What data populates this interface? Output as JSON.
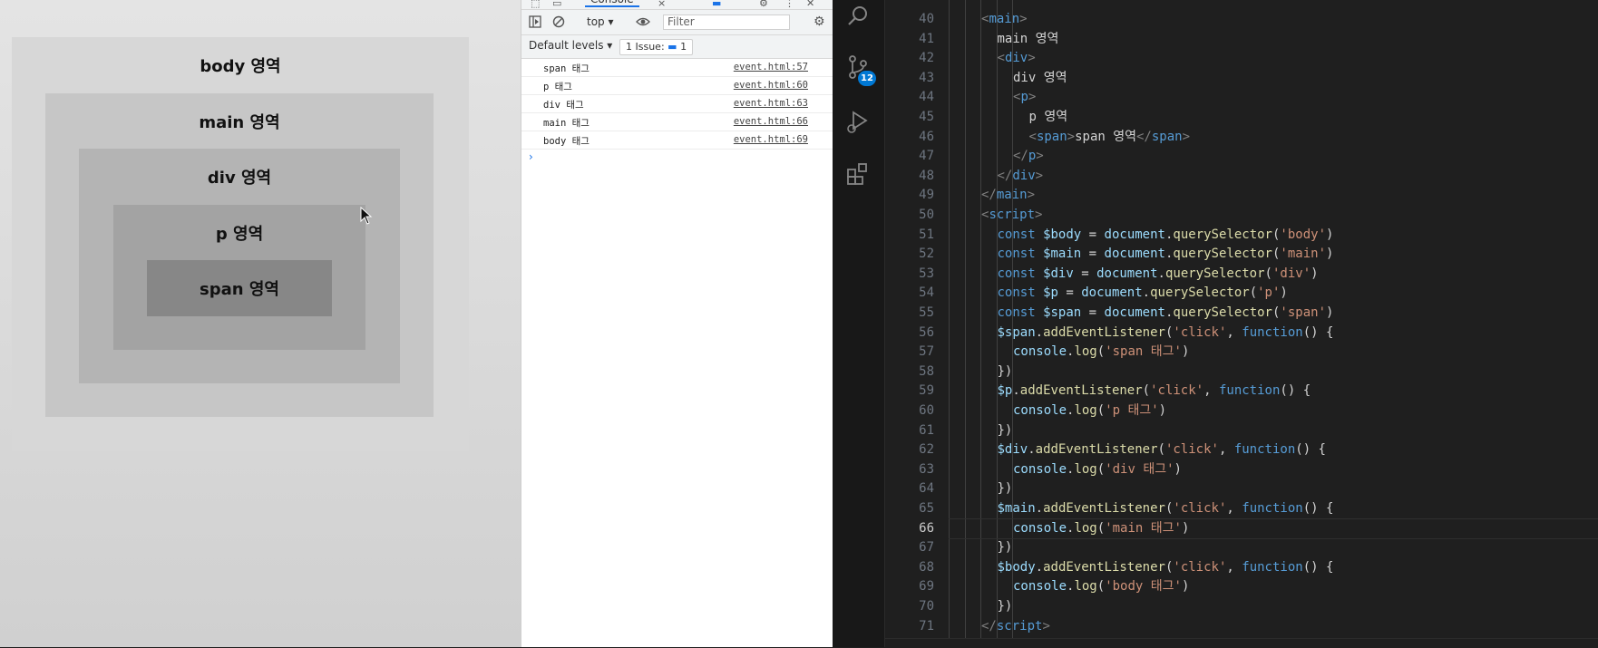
{
  "browser_page": {
    "body_label": "body 영역",
    "main_label": "main 영역",
    "div_label": "div 영역",
    "p_label": "p 영역",
    "span_label": "span 영역"
  },
  "devtools": {
    "tab_console": "Console",
    "context_select": "top",
    "filter_placeholder": "Filter",
    "levels_select": "Default levels",
    "issue_text": "1 Issue:",
    "issue_count": "1",
    "console_rows": [
      {
        "msg": "span 태그",
        "src": "event.html:57"
      },
      {
        "msg": "p 태그",
        "src": "event.html:60"
      },
      {
        "msg": "div 태그",
        "src": "event.html:63"
      },
      {
        "msg": "main 태그",
        "src": "event.html:66"
      },
      {
        "msg": "body 태그",
        "src": "event.html:69"
      }
    ],
    "prompt_symbol": "›"
  },
  "vscode": {
    "scm_badge": "12",
    "current_line": 66,
    "lines": [
      {
        "n": "40",
        "indent": 2,
        "segs": [
          [
            "tag",
            "<"
          ],
          [
            "tagname",
            "main"
          ],
          [
            "tag",
            ">"
          ]
        ]
      },
      {
        "n": "41",
        "indent": 3,
        "segs": [
          [
            "txt",
            "main 영역"
          ]
        ]
      },
      {
        "n": "42",
        "indent": 3,
        "segs": [
          [
            "tag",
            "<"
          ],
          [
            "tagname",
            "div"
          ],
          [
            "tag",
            ">"
          ]
        ]
      },
      {
        "n": "43",
        "indent": 4,
        "segs": [
          [
            "txt",
            "div 영역"
          ]
        ]
      },
      {
        "n": "44",
        "indent": 4,
        "segs": [
          [
            "tag",
            "<"
          ],
          [
            "tagname",
            "p"
          ],
          [
            "tag",
            ">"
          ]
        ]
      },
      {
        "n": "45",
        "indent": 5,
        "segs": [
          [
            "txt",
            "p 영역"
          ]
        ]
      },
      {
        "n": "46",
        "indent": 5,
        "segs": [
          [
            "tag",
            "<"
          ],
          [
            "tagname",
            "span"
          ],
          [
            "tag",
            ">"
          ],
          [
            "txt",
            "span 영역"
          ],
          [
            "tag",
            "</"
          ],
          [
            "tagname",
            "span"
          ],
          [
            "tag",
            ">"
          ]
        ]
      },
      {
        "n": "47",
        "indent": 4,
        "segs": [
          [
            "tag",
            "</"
          ],
          [
            "tagname",
            "p"
          ],
          [
            "tag",
            ">"
          ]
        ]
      },
      {
        "n": "48",
        "indent": 3,
        "segs": [
          [
            "tag",
            "</"
          ],
          [
            "tagname",
            "div"
          ],
          [
            "tag",
            ">"
          ]
        ]
      },
      {
        "n": "49",
        "indent": 2,
        "segs": [
          [
            "tag",
            "</"
          ],
          [
            "tagname",
            "main"
          ],
          [
            "tag",
            ">"
          ]
        ]
      },
      {
        "n": "50",
        "indent": 2,
        "segs": [
          [
            "tag",
            "<"
          ],
          [
            "tagname",
            "script"
          ],
          [
            "tag",
            ">"
          ]
        ]
      },
      {
        "n": "51",
        "indent": 3,
        "segs": [
          [
            "kw",
            "const "
          ],
          [
            "var",
            "$body"
          ],
          [
            "txt",
            " = "
          ],
          [
            "var",
            "document"
          ],
          [
            "txt",
            "."
          ],
          [
            "fn",
            "querySelector"
          ],
          [
            "txt",
            "("
          ],
          [
            "str",
            "'body'"
          ],
          [
            "txt",
            ")"
          ]
        ]
      },
      {
        "n": "52",
        "indent": 3,
        "segs": [
          [
            "kw",
            "const "
          ],
          [
            "var",
            "$main"
          ],
          [
            "txt",
            " = "
          ],
          [
            "var",
            "document"
          ],
          [
            "txt",
            "."
          ],
          [
            "fn",
            "querySelector"
          ],
          [
            "txt",
            "("
          ],
          [
            "str",
            "'main'"
          ],
          [
            "txt",
            ")"
          ]
        ]
      },
      {
        "n": "53",
        "indent": 3,
        "segs": [
          [
            "kw",
            "const "
          ],
          [
            "var",
            "$div"
          ],
          [
            "txt",
            " = "
          ],
          [
            "var",
            "document"
          ],
          [
            "txt",
            "."
          ],
          [
            "fn",
            "querySelector"
          ],
          [
            "txt",
            "("
          ],
          [
            "str",
            "'div'"
          ],
          [
            "txt",
            ")"
          ]
        ]
      },
      {
        "n": "54",
        "indent": 3,
        "segs": [
          [
            "kw",
            "const "
          ],
          [
            "var",
            "$p"
          ],
          [
            "txt",
            " = "
          ],
          [
            "var",
            "document"
          ],
          [
            "txt",
            "."
          ],
          [
            "fn",
            "querySelector"
          ],
          [
            "txt",
            "("
          ],
          [
            "str",
            "'p'"
          ],
          [
            "txt",
            ")"
          ]
        ]
      },
      {
        "n": "55",
        "indent": 3,
        "segs": [
          [
            "kw",
            "const "
          ],
          [
            "var",
            "$span"
          ],
          [
            "txt",
            " = "
          ],
          [
            "var",
            "document"
          ],
          [
            "txt",
            "."
          ],
          [
            "fn",
            "querySelector"
          ],
          [
            "txt",
            "("
          ],
          [
            "str",
            "'span'"
          ],
          [
            "txt",
            ")"
          ]
        ]
      },
      {
        "n": "56",
        "indent": 3,
        "segs": [
          [
            "var",
            "$span"
          ],
          [
            "txt",
            "."
          ],
          [
            "fn",
            "addEventListener"
          ],
          [
            "txt",
            "("
          ],
          [
            "str",
            "'click'"
          ],
          [
            "txt",
            ", "
          ],
          [
            "kw",
            "function"
          ],
          [
            "txt",
            "() {"
          ]
        ]
      },
      {
        "n": "57",
        "indent": 4,
        "segs": [
          [
            "var",
            "console"
          ],
          [
            "txt",
            "."
          ],
          [
            "fn",
            "log"
          ],
          [
            "txt",
            "("
          ],
          [
            "str",
            "'span 태그'"
          ],
          [
            "txt",
            ")"
          ]
        ]
      },
      {
        "n": "58",
        "indent": 3,
        "segs": [
          [
            "txt",
            "})"
          ]
        ]
      },
      {
        "n": "59",
        "indent": 3,
        "segs": [
          [
            "var",
            "$p"
          ],
          [
            "txt",
            "."
          ],
          [
            "fn",
            "addEventListener"
          ],
          [
            "txt",
            "("
          ],
          [
            "str",
            "'click'"
          ],
          [
            "txt",
            ", "
          ],
          [
            "kw",
            "function"
          ],
          [
            "txt",
            "() {"
          ]
        ]
      },
      {
        "n": "60",
        "indent": 4,
        "segs": [
          [
            "var",
            "console"
          ],
          [
            "txt",
            "."
          ],
          [
            "fn",
            "log"
          ],
          [
            "txt",
            "("
          ],
          [
            "str",
            "'p 태그'"
          ],
          [
            "txt",
            ")"
          ]
        ]
      },
      {
        "n": "61",
        "indent": 3,
        "segs": [
          [
            "txt",
            "})"
          ]
        ]
      },
      {
        "n": "62",
        "indent": 3,
        "segs": [
          [
            "var",
            "$div"
          ],
          [
            "txt",
            "."
          ],
          [
            "fn",
            "addEventListener"
          ],
          [
            "txt",
            "("
          ],
          [
            "str",
            "'click'"
          ],
          [
            "txt",
            ", "
          ],
          [
            "kw",
            "function"
          ],
          [
            "txt",
            "() {"
          ]
        ]
      },
      {
        "n": "63",
        "indent": 4,
        "segs": [
          [
            "var",
            "console"
          ],
          [
            "txt",
            "."
          ],
          [
            "fn",
            "log"
          ],
          [
            "txt",
            "("
          ],
          [
            "str",
            "'div 태그'"
          ],
          [
            "txt",
            ")"
          ]
        ]
      },
      {
        "n": "64",
        "indent": 3,
        "segs": [
          [
            "txt",
            "})"
          ]
        ]
      },
      {
        "n": "65",
        "indent": 3,
        "segs": [
          [
            "var",
            "$main"
          ],
          [
            "txt",
            "."
          ],
          [
            "fn",
            "addEventListener"
          ],
          [
            "txt",
            "("
          ],
          [
            "str",
            "'click'"
          ],
          [
            "txt",
            ", "
          ],
          [
            "kw",
            "function"
          ],
          [
            "txt",
            "() {"
          ]
        ]
      },
      {
        "n": "66",
        "indent": 4,
        "segs": [
          [
            "var",
            "console"
          ],
          [
            "txt",
            "."
          ],
          [
            "fn",
            "log"
          ],
          [
            "txt",
            "("
          ],
          [
            "str",
            "'main 태그'"
          ],
          [
            "txt",
            ")"
          ]
        ]
      },
      {
        "n": "67",
        "indent": 3,
        "segs": [
          [
            "txt",
            "})"
          ]
        ]
      },
      {
        "n": "68",
        "indent": 3,
        "segs": [
          [
            "var",
            "$body"
          ],
          [
            "txt",
            "."
          ],
          [
            "fn",
            "addEventListener"
          ],
          [
            "txt",
            "("
          ],
          [
            "str",
            "'click'"
          ],
          [
            "txt",
            ", "
          ],
          [
            "kw",
            "function"
          ],
          [
            "txt",
            "() {"
          ]
        ]
      },
      {
        "n": "69",
        "indent": 4,
        "segs": [
          [
            "var",
            "console"
          ],
          [
            "txt",
            "."
          ],
          [
            "fn",
            "log"
          ],
          [
            "txt",
            "("
          ],
          [
            "str",
            "'body 태그'"
          ],
          [
            "txt",
            ")"
          ]
        ]
      },
      {
        "n": "70",
        "indent": 3,
        "segs": [
          [
            "txt",
            "})"
          ]
        ]
      },
      {
        "n": "71",
        "indent": 2,
        "segs": [
          [
            "tag",
            "</"
          ],
          [
            "tagname",
            "script"
          ],
          [
            "tag",
            ">"
          ]
        ]
      }
    ]
  }
}
